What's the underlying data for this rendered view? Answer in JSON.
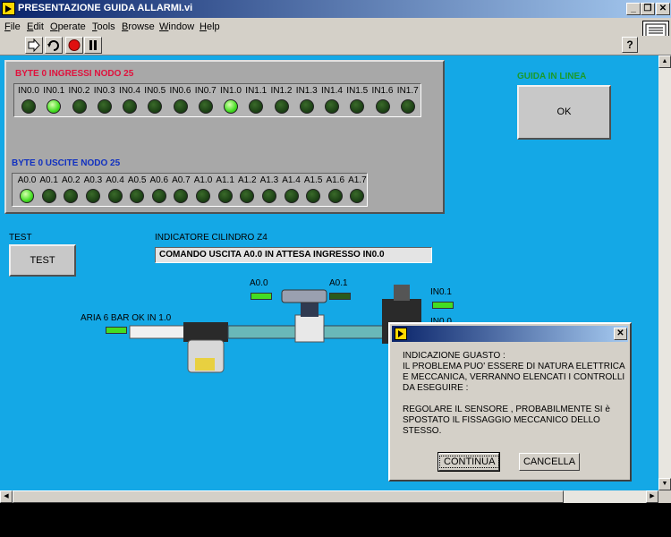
{
  "window": {
    "title": "PRESENTAZIONE GUIDA ALLARMI.vi"
  },
  "menu": [
    "File",
    "Edit",
    "Operate",
    "Tools",
    "Browse",
    "Window",
    "Help"
  ],
  "toolbar": {
    "help": "?"
  },
  "inputs": {
    "title": "BYTE 0 INGRESSI  NODO 25",
    "labels": [
      "IN0.0",
      "IN0.1",
      "IN0.2",
      "IN0.3",
      "IN0.4",
      "IN0.5",
      "IN0.6",
      "IN0.7",
      "IN1.0",
      "IN1.1",
      "IN1.2",
      "IN1.3",
      "IN1.4",
      "IN1.5",
      "IN1.6",
      "IN1.7"
    ],
    "states": [
      false,
      true,
      false,
      false,
      false,
      false,
      false,
      false,
      true,
      false,
      false,
      false,
      false,
      false,
      false,
      false
    ]
  },
  "outputs": {
    "title": "BYTE 0 USCITE NODO 25",
    "labels": [
      "A0.0",
      "A0.1",
      "A0.2",
      "A0.3",
      "A0.4",
      "A0.5",
      "A0.6",
      "A0.7",
      "A1.0",
      "A1.1",
      "A1.2",
      "A1.3",
      "A1.4",
      "A1.5",
      "A1.6",
      "A1.7"
    ],
    "states": [
      true,
      false,
      false,
      false,
      false,
      false,
      false,
      false,
      false,
      false,
      false,
      false,
      false,
      false,
      false,
      false
    ]
  },
  "guide": {
    "label": "GUIDA IN LINEA",
    "button": "OK"
  },
  "test": {
    "label": "TEST",
    "button": "TEST"
  },
  "cylinder": {
    "label": "INDICATORE CILINDRO Z4",
    "value": "COMANDO USCITA A0.0 IN ATTESA INGRESSO IN0.0"
  },
  "schematic": {
    "a00": "A0.0",
    "a01": "A0.1",
    "in01": "IN0.1",
    "in00": "IN0.0",
    "air": "ARIA 6 BAR OK IN 1.0"
  },
  "dialog": {
    "text": "INDICAZIONE GUASTO :\nIL PROBLEMA PUO' ESSERE DI NATURA ELETTRICA E MECCANICA, VERRANNO ELENCATI I CONTROLLI  DA ESEGUIRE :\n\nREGOLARE IL SENSORE , PROBABILMENTE SI è SPOSTATO IL FISSAGGIO MECCANICO DELLO STESSO.",
    "continue": "CONTINUA",
    "cancel": "CANCELLA"
  },
  "colors": {
    "panel": "#14a8e6",
    "led_on": "#44dd22",
    "title_red": "#e0103c",
    "title_blue": "#1030c0",
    "guide_green": "#1a9a2a"
  }
}
